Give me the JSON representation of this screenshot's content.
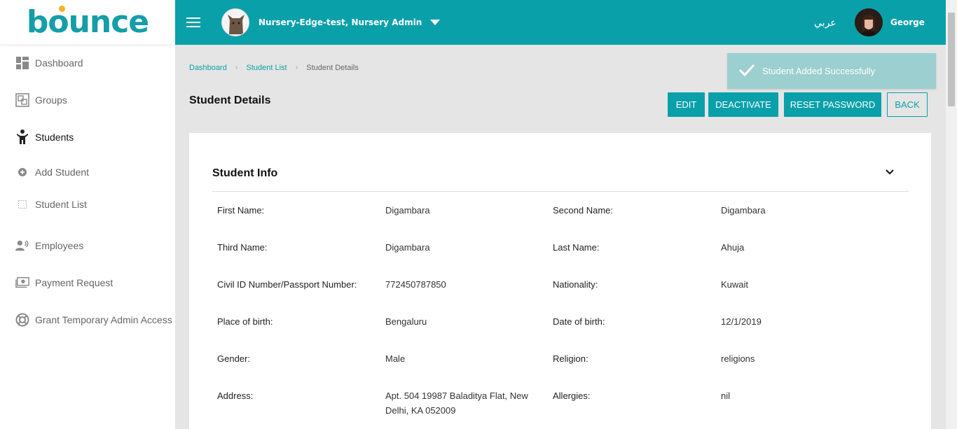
{
  "brand": {
    "name": "bounce",
    "color": "#0aa0aa",
    "dot_color": "#f5b324"
  },
  "sidebar": {
    "items": [
      {
        "label": "Dashboard",
        "icon": "dashboard-icon"
      },
      {
        "label": "Groups",
        "icon": "groups-icon"
      },
      {
        "label": "Students",
        "icon": "student-icon"
      },
      {
        "label": "Add Student",
        "icon": "add-circle-icon"
      },
      {
        "label": "Student List",
        "icon": "list-icon"
      },
      {
        "label": "Employees",
        "icon": "employees-icon"
      },
      {
        "label": "Payment Request",
        "icon": "payment-icon"
      },
      {
        "label": "Grant Temporary Admin Access",
        "icon": "lifebuoy-icon"
      }
    ]
  },
  "topbar": {
    "org": "Nursery-Edge-test, Nursery Admin",
    "language": "عربي",
    "user": "George"
  },
  "breadcrumb": {
    "home": "Dashboard",
    "list": "Student List",
    "current": "Student Details"
  },
  "page_title": "Student Details",
  "actions": {
    "edit": "EDIT",
    "deactivate": "DEACTIVATE",
    "reset": "RESET PASSWORD",
    "back": "BACK"
  },
  "toast": {
    "message": "Student Added Successfully"
  },
  "student_info": {
    "title": "Student Info",
    "fields": [
      {
        "label": "First Name:",
        "value": "Digambara"
      },
      {
        "label": "Second Name:",
        "value": "Digambara"
      },
      {
        "label": "Third Name:",
        "value": "Digambara"
      },
      {
        "label": "Last Name:",
        "value": "Ahuja"
      },
      {
        "label": "Civil ID Number/Passport Number:",
        "value": "772450787850"
      },
      {
        "label": "Nationality:",
        "value": "Kuwait"
      },
      {
        "label": "Place of birth:",
        "value": "Bengaluru"
      },
      {
        "label": "Date of birth:",
        "value": "12/1/2019"
      },
      {
        "label": "Gender:",
        "value": "Male"
      },
      {
        "label": "Religion:",
        "value": "religions"
      },
      {
        "label": "Address:",
        "value": "Apt. 504 19987 Baladitya Flat, New Delhi, KA 052009"
      },
      {
        "label": "Allergies:",
        "value": "nil"
      }
    ]
  }
}
